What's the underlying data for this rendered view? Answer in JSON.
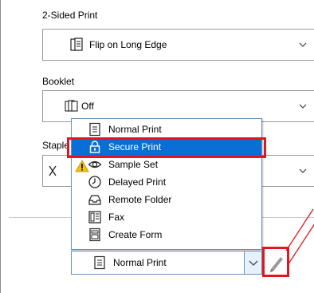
{
  "sections": {
    "two_sided": {
      "label": "2-Sided Print",
      "value": "Flip on Long Edge"
    },
    "booklet": {
      "label": "Booklet",
      "value": "Off"
    },
    "staple": {
      "label": "Staple"
    }
  },
  "job_type_dropdown": {
    "options": [
      {
        "label": "Normal Print",
        "icon": "document-icon"
      },
      {
        "label": "Secure Print",
        "icon": "lock-icon",
        "selected": true
      },
      {
        "label": "Sample Set",
        "icon": "eye-icon"
      },
      {
        "label": "Delayed Print",
        "icon": "clock-icon"
      },
      {
        "label": "Remote Folder",
        "icon": "tray-icon"
      },
      {
        "label": "Fax",
        "icon": "fax-icon"
      },
      {
        "label": "Create Form",
        "icon": "form-icon"
      }
    ],
    "current_value": "Normal Print"
  },
  "colors": {
    "highlight": "#0a6fd4",
    "callout_red": "#e4161c",
    "warning_yellow": "#f5c400"
  }
}
